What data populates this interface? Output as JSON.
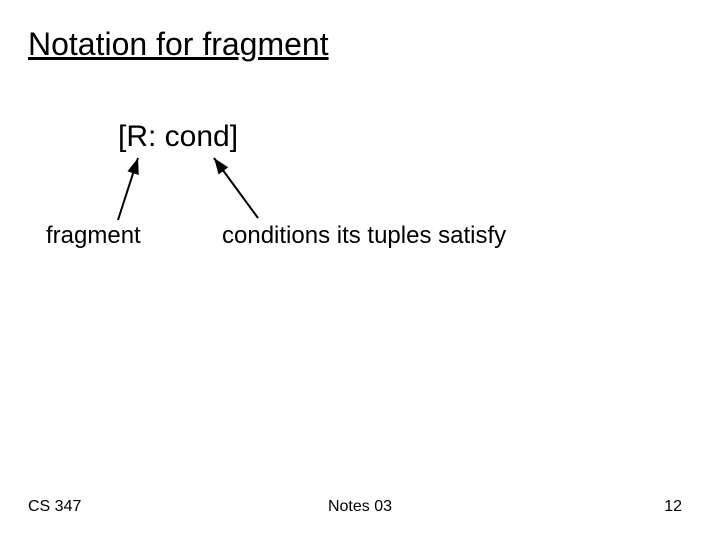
{
  "slide": {
    "title": "Notation for fragment",
    "notation": "[R:  cond]",
    "label_fragment": "fragment",
    "label_conditions": "conditions its tuples satisfy"
  },
  "footer": {
    "left": "CS 347",
    "center": "Notes 03",
    "right": "12"
  }
}
